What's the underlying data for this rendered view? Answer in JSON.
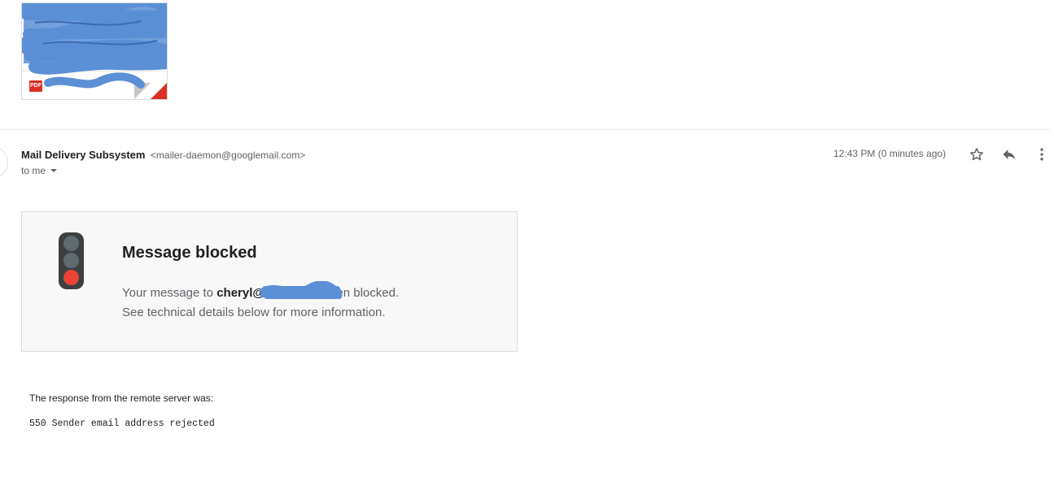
{
  "attachment": {
    "badge": "PDF",
    "icon": "pdf-icon",
    "redacted": true,
    "redaction_color": "#5b8fd6"
  },
  "message": {
    "sender_name": "Mail Delivery Subsystem",
    "sender_email": "<mailer-daemon@googlemail.com>",
    "recipient": "to me",
    "timestamp": "12:43 PM (0 minutes ago)",
    "actions": {
      "star_icon": "star-icon",
      "reply_icon": "reply-icon",
      "more_icon": "more-vertical-icon"
    }
  },
  "notice": {
    "icon": "traffic-light-icon",
    "title": "Message blocked",
    "body_prefix": "Your message to ",
    "recipient_address": "cheryl@ .com",
    "body_suffix": " has been blocked.",
    "body_line2": "See technical details below for more information.",
    "colors": {
      "light_off": "#5f6b70",
      "light_red": "#ea4335",
      "housing": "#3c4043"
    }
  },
  "technical": {
    "label": "The response from the remote server was:",
    "code": "550 Sender email address rejected"
  }
}
